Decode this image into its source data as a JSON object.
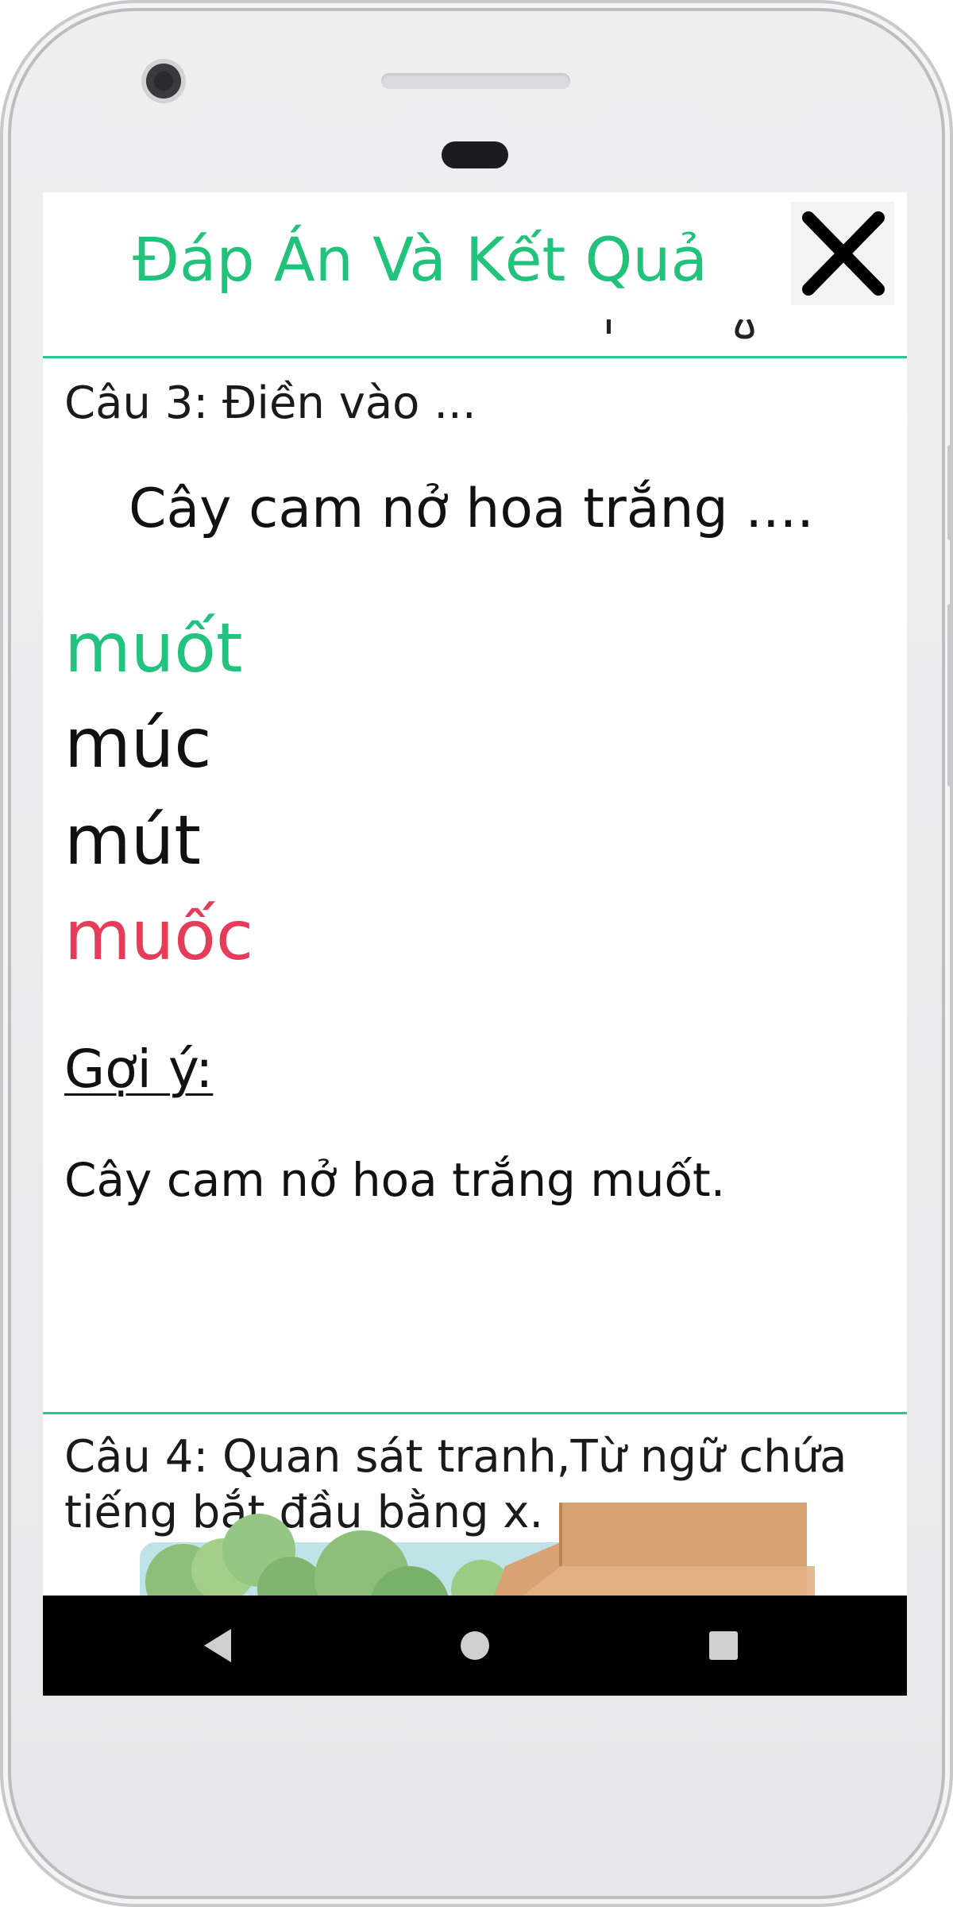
{
  "header": {
    "title": "Đáp Án Và Kết Quả",
    "close_icon": "close-icon"
  },
  "question3": {
    "label": "Câu 3: Điền vào ...",
    "sentence": "Cây cam nở hoa trắng ....",
    "options": [
      {
        "text": "muốt",
        "status": "correct",
        "color": "#22c27f"
      },
      {
        "text": "múc",
        "status": "neutral",
        "color": "#111111"
      },
      {
        "text": "mút",
        "status": "neutral",
        "color": "#111111"
      },
      {
        "text": "muốc",
        "status": "wrong",
        "color": "#e63c5a"
      }
    ],
    "hint_title": "Gợi ý:",
    "hint_text": "Cây cam nở hoa trắng muốt."
  },
  "question4": {
    "label": "Câu 4: Quan sát tranh,Từ ngữ chứa tiếng bắt đầu bằng x."
  },
  "navbar": {
    "back_icon": "back-triangle-icon",
    "home_icon": "home-circle-icon",
    "recents_icon": "recents-square-icon"
  },
  "colors": {
    "accent": "#21c27a",
    "correct": "#22c27f",
    "wrong": "#e63c5a",
    "navbar": "#000000"
  }
}
